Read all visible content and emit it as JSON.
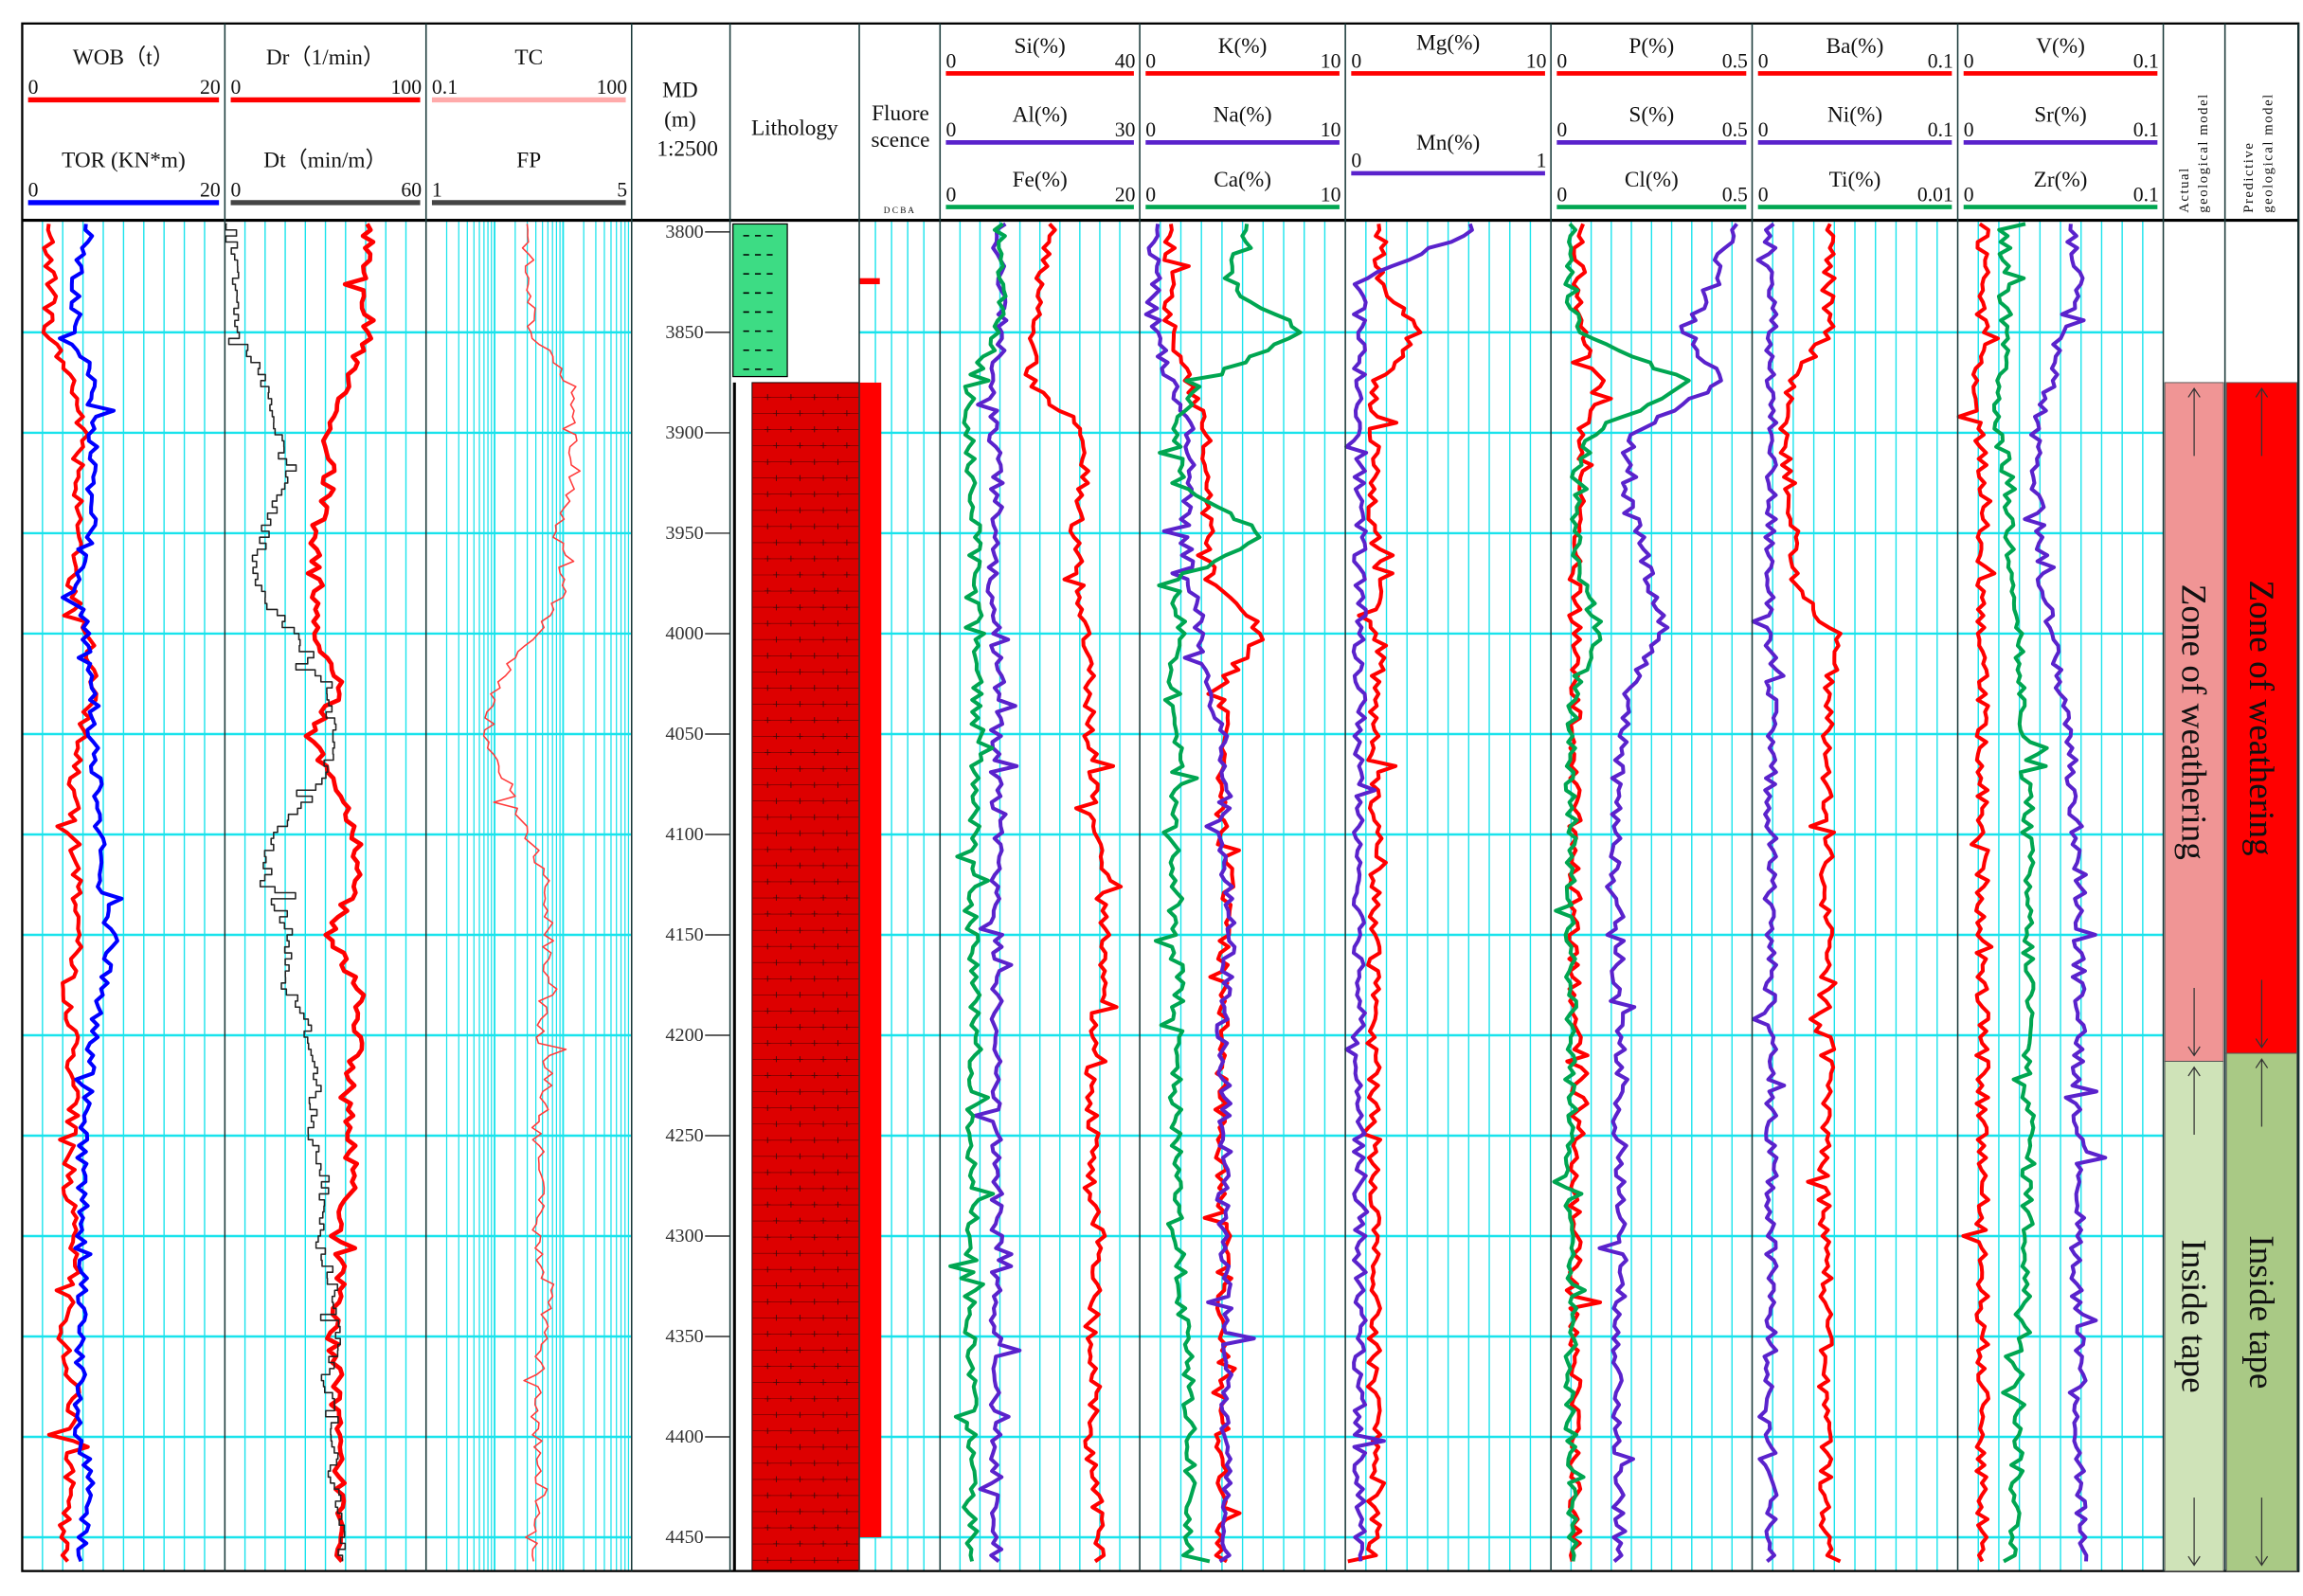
{
  "chart_data": {
    "type": "line",
    "title": "",
    "depth_axis": {
      "label": "MD",
      "unit": "(m)",
      "scale": "1:2500",
      "ticks": [
        3800,
        3850,
        3900,
        3950,
        4000,
        4050,
        4100,
        4150,
        4200,
        4250,
        4300,
        4350,
        4400,
        4450
      ],
      "range": [
        3794,
        4467
      ]
    },
    "depths": [
      3800,
      3825,
      3850,
      3875,
      3900,
      3925,
      3950,
      3975,
      4000,
      4025,
      4050,
      4075,
      4100,
      4125,
      4150,
      4175,
      4200,
      4225,
      4250,
      4275,
      4300,
      4325,
      4350,
      4375,
      4400,
      4425,
      4450
    ],
    "tracks": [
      {
        "id": "wob",
        "headers": [
          {
            "label": "WOB（t）",
            "min": "0",
            "max": "20",
            "color": "#ff0000"
          },
          {
            "label": "TOR (KN*m)",
            "min": "0",
            "max": "20",
            "color": "#0000ff"
          }
        ]
      },
      {
        "id": "dr",
        "headers": [
          {
            "label": "Dr（1/min）",
            "min": "0",
            "max": "100",
            "color": "#ff0000"
          },
          {
            "label": "Dt（min/m）",
            "min": "0",
            "max": "60",
            "color": "#444444"
          }
        ]
      },
      {
        "id": "tc",
        "headers": [
          {
            "label": "TC",
            "min": "0.1",
            "max": "100",
            "color": "#ffaaaa"
          },
          {
            "label": "FP",
            "min": "1",
            "max": "5",
            "color": "#444444"
          }
        ]
      },
      {
        "id": "si",
        "headers": [
          {
            "label": "Si(%)",
            "min": "0",
            "max": "40",
            "color": "#ff0000"
          },
          {
            "label": "Al(%)",
            "min": "0",
            "max": "30",
            "color": "#5a22cc"
          },
          {
            "label": "Fe(%)",
            "min": "0",
            "max": "20",
            "color": "#00a651"
          }
        ]
      },
      {
        "id": "k",
        "headers": [
          {
            "label": "K(%)",
            "min": "0",
            "max": "10",
            "color": "#ff0000"
          },
          {
            "label": "Na(%)",
            "min": "0",
            "max": "10",
            "color": "#5a22cc"
          },
          {
            "label": "Ca(%)",
            "min": "0",
            "max": "10",
            "color": "#00a651"
          }
        ]
      },
      {
        "id": "mg",
        "headers": [
          {
            "label": "Mg(%)",
            "min": "0",
            "max": "10",
            "color": "#ff0000"
          },
          {
            "label": "Mn(%)",
            "min": "0",
            "max": "1",
            "color": "#5a22cc"
          }
        ]
      },
      {
        "id": "p",
        "headers": [
          {
            "label": "P(%)",
            "min": "0",
            "max": "0.5",
            "color": "#ff0000"
          },
          {
            "label": "S(%)",
            "min": "0",
            "max": "0.5",
            "color": "#5a22cc"
          },
          {
            "label": "Cl(%)",
            "min": "0",
            "max": "0.5",
            "color": "#00a651"
          }
        ]
      },
      {
        "id": "ba",
        "headers": [
          {
            "label": "Ba(%)",
            "min": "0",
            "max": "0.1",
            "color": "#ff0000"
          },
          {
            "label": "Ni(%)",
            "min": "0",
            "max": "0.1",
            "color": "#5a22cc"
          },
          {
            "label": "Ti(%)",
            "min": "0",
            "max": "0.01",
            "color": "#00a651"
          }
        ]
      },
      {
        "id": "v",
        "headers": [
          {
            "label": "V(%)",
            "min": "0",
            "max": "0.1",
            "color": "#ff0000"
          },
          {
            "label": "Sr(%)",
            "min": "0",
            "max": "0.1",
            "color": "#5a22cc"
          },
          {
            "label": "Zr(%)",
            "min": "0",
            "max": "0.1",
            "color": "#00a651"
          }
        ]
      }
    ],
    "series": [
      {
        "name": "WOB",
        "track": "wob",
        "min": 0,
        "max": 20,
        "color": "#ff0000",
        "values": [
          2.5,
          3,
          2.5,
          5,
          6,
          5.5,
          6,
          4.5,
          6.5,
          7,
          6,
          5,
          5,
          5.5,
          5.5,
          4.5,
          5,
          5,
          5,
          4.5,
          5,
          5,
          4,
          5,
          5,
          4.5,
          4
        ]
      },
      {
        "name": "TOR",
        "track": "wob",
        "min": 0,
        "max": 20,
        "color": "#0000ff",
        "values": [
          6.5,
          5.5,
          5,
          7,
          7,
          7,
          7,
          5,
          6.5,
          7,
          7,
          7.5,
          8,
          7.5,
          9,
          8,
          7,
          6.5,
          6,
          6,
          6,
          6,
          6,
          5.5,
          5.5,
          7,
          6
        ]
      },
      {
        "name": "Dr",
        "track": "dr",
        "min": 0,
        "max": 100,
        "color": "#ff0000",
        "values": [
          71,
          71,
          71,
          60,
          50,
          52,
          45,
          44,
          45,
          58,
          42,
          55,
          66,
          66,
          52,
          66,
          67,
          60,
          62,
          64,
          55,
          58,
          54,
          56,
          55,
          58,
          56
        ]
      },
      {
        "name": "Dt",
        "track": "dr",
        "min": 0,
        "max": 60,
        "color": "#222222",
        "values": [
          2,
          4,
          4,
          12,
          15,
          18,
          12,
          8,
          20,
          30,
          32,
          30,
          15,
          12,
          20,
          18,
          25,
          28,
          25,
          30,
          28,
          32,
          35,
          30,
          33,
          32,
          35
        ]
      },
      {
        "name": "TC",
        "track": "tc",
        "min": 0.1,
        "max": 100,
        "log": true,
        "color": "#ff3b3b",
        "values": [
          3,
          3.5,
          3.5,
          12,
          14,
          15,
          8,
          12,
          4,
          1,
          0.8,
          1.5,
          3,
          6,
          6,
          5,
          5,
          6,
          4,
          5,
          4,
          6,
          5,
          4,
          4,
          5,
          4
        ]
      },
      {
        "name": "Si",
        "track": "si",
        "min": 0,
        "max": 40,
        "color": "#ff0000",
        "values": [
          22,
          20,
          19,
          18,
          28,
          29,
          27,
          28,
          29,
          30,
          30,
          31,
          31,
          32,
          33,
          32,
          31,
          30,
          31,
          30,
          32,
          31,
          30,
          31,
          30,
          31,
          32
        ]
      },
      {
        "name": "Al",
        "track": "si",
        "min": 0,
        "max": 30,
        "color": "#5a22cc",
        "values": [
          9,
          9,
          9.5,
          8,
          8,
          8.5,
          8.5,
          8,
          8.5,
          8.5,
          8.5,
          8.5,
          8.5,
          8.5,
          8.5,
          8.5,
          8.5,
          8.5,
          8.5,
          8.5,
          8.5,
          8.5,
          8.5,
          8.5,
          8.5,
          8.5,
          8.5
        ]
      },
      {
        "name": "Fe",
        "track": "si",
        "min": 0,
        "max": 20,
        "color": "#00a651",
        "values": [
          6,
          6,
          6,
          3,
          3,
          3.2,
          3.5,
          3.5,
          4,
          3.6,
          3.8,
          3.6,
          3.4,
          3.4,
          3.2,
          3.4,
          3.6,
          3.4,
          3.2,
          3.4,
          3.2,
          3,
          3,
          3.2,
          3,
          3.2,
          3.2
        ]
      },
      {
        "name": "K",
        "track": "k",
        "min": 0,
        "max": 10,
        "color": "#ff0000",
        "values": [
          1.4,
          1.4,
          1.5,
          2.5,
          3.2,
          3.2,
          3.4,
          3.4,
          6,
          4,
          4.2,
          4,
          4,
          4.3,
          4.2,
          4,
          4.1,
          4,
          3.9,
          4,
          4.2,
          4,
          4,
          4.2,
          4,
          4,
          4
        ]
      },
      {
        "name": "Na",
        "track": "k",
        "min": 0,
        "max": 10,
        "color": "#5a22cc",
        "values": [
          0.7,
          0.7,
          0.8,
          1.5,
          2.5,
          2.5,
          2.2,
          2.5,
          3,
          3.2,
          4,
          4.2,
          4,
          4.2,
          4.4,
          4.2,
          4,
          4.1,
          4.2,
          4,
          4.1,
          4.2,
          4.3,
          4.2,
          4.1,
          4.2,
          4.1
        ]
      },
      {
        "name": "Ca",
        "track": "k",
        "min": 0,
        "max": 10,
        "color": "#00a651",
        "values": [
          5.3,
          4,
          8,
          3,
          1.7,
          2,
          6,
          1.8,
          2,
          1.6,
          1.8,
          1.8,
          1.7,
          1.8,
          1.7,
          1.9,
          1.8,
          1.7,
          1.8,
          1.9,
          1.8,
          2,
          2.2,
          2.4,
          2.4,
          2.5,
          2.3
        ]
      },
      {
        "name": "Mg",
        "track": "mg",
        "min": 0,
        "max": 10,
        "color": "#ff0000",
        "values": [
          1.7,
          1.7,
          3.5,
          1.5,
          1.4,
          1.4,
          1.4,
          1.5,
          1.5,
          1.4,
          1.4,
          1.4,
          1.5,
          1.4,
          1.4,
          1.4,
          1.5,
          1.4,
          1.4,
          1.5,
          1.4,
          1.4,
          1.4,
          1.4,
          1.5,
          1.4,
          1.4
        ]
      },
      {
        "name": "Mn",
        "track": "mg",
        "min": 0,
        "max": 1,
        "color": "#5a22cc",
        "values": [
          0.6,
          0.07,
          0.07,
          0.07,
          0.07,
          0.07,
          0.07,
          0.07,
          0.07,
          0.07,
          0.07,
          0.07,
          0.07,
          0.07,
          0.07,
          0.07,
          0.07,
          0.07,
          0.07,
          0.07,
          0.07,
          0.07,
          0.07,
          0.07,
          0.07,
          0.07,
          0.07
        ]
      },
      {
        "name": "P",
        "track": "p",
        "min": 0,
        "max": 0.5,
        "color": "#ff0000",
        "values": [
          0.07,
          0.07,
          0.08,
          0.12,
          0.08,
          0.07,
          0.07,
          0.06,
          0.06,
          0.06,
          0.06,
          0.06,
          0.06,
          0.06,
          0.06,
          0.06,
          0.06,
          0.06,
          0.07,
          0.06,
          0.06,
          0.06,
          0.06,
          0.06,
          0.06,
          0.06,
          0.06
        ]
      },
      {
        "name": "S",
        "track": "p",
        "min": 0,
        "max": 0.5,
        "color": "#5a22cc",
        "values": [
          0.45,
          0.4,
          0.34,
          0.42,
          0.2,
          0.18,
          0.22,
          0.25,
          0.28,
          0.2,
          0.18,
          0.16,
          0.17,
          0.15,
          0.18,
          0.16,
          0.17,
          0.18,
          0.16,
          0.17,
          0.18,
          0.17,
          0.17,
          0.16,
          0.17,
          0.17,
          0.17
        ]
      },
      {
        "name": "Cl",
        "track": "p",
        "min": 0,
        "max": 0.5,
        "color": "#00a651",
        "values": [
          0.05,
          0.05,
          0.06,
          0.35,
          0.1,
          0.06,
          0.06,
          0.08,
          0.12,
          0.06,
          0.05,
          0.05,
          0.05,
          0.05,
          0.05,
          0.05,
          0.05,
          0.05,
          0.05,
          0.05,
          0.05,
          0.05,
          0.05,
          0.05,
          0.05,
          0.05,
          0.05
        ]
      },
      {
        "name": "Ba",
        "track": "ba",
        "min": 0,
        "max": 0.1,
        "color": "#ff0000",
        "values": [
          0.037,
          0.037,
          0.037,
          0.02,
          0.016,
          0.018,
          0.02,
          0.02,
          0.04,
          0.038,
          0.036,
          0.036,
          0.037,
          0.036,
          0.036,
          0.035,
          0.036,
          0.037,
          0.036,
          0.035,
          0.036,
          0.036,
          0.036,
          0.035,
          0.036,
          0.036,
          0.036
        ]
      },
      {
        "name": "Ni",
        "track": "ba",
        "min": 0,
        "max": 0.1,
        "color": "#5a22cc",
        "values": [
          0.009,
          0.009,
          0.009,
          0.009,
          0.009,
          0.009,
          0.009,
          0.009,
          0.009,
          0.009,
          0.009,
          0.009,
          0.009,
          0.009,
          0.009,
          0.009,
          0.009,
          0.009,
          0.009,
          0.009,
          0.009,
          0.009,
          0.009,
          0.009,
          0.009,
          0.009,
          0.009
        ]
      },
      {
        "name": "V",
        "track": "v",
        "min": 0,
        "max": 0.1,
        "color": "#ff0000",
        "values": [
          0.012,
          0.012,
          0.012,
          0.01,
          0.011,
          0.012,
          0.012,
          0.012,
          0.012,
          0.012,
          0.012,
          0.012,
          0.012,
          0.012,
          0.012,
          0.012,
          0.012,
          0.012,
          0.012,
          0.012,
          0.012,
          0.012,
          0.012,
          0.012,
          0.012,
          0.012,
          0.012
        ]
      },
      {
        "name": "Sr",
        "track": "v",
        "min": 0,
        "max": 0.1,
        "color": "#5a22cc",
        "values": [
          0.055,
          0.06,
          0.05,
          0.045,
          0.037,
          0.038,
          0.04,
          0.042,
          0.045,
          0.05,
          0.055,
          0.055,
          0.058,
          0.06,
          0.058,
          0.06,
          0.06,
          0.058,
          0.06,
          0.06,
          0.058,
          0.058,
          0.06,
          0.06,
          0.058,
          0.06,
          0.06
        ]
      },
      {
        "name": "Zr",
        "track": "v",
        "min": 0,
        "max": 0.1,
        "color": "#00a651",
        "values": [
          0.023,
          0.023,
          0.023,
          0.02,
          0.02,
          0.025,
          0.025,
          0.028,
          0.03,
          0.03,
          0.032,
          0.034,
          0.034,
          0.034,
          0.034,
          0.035,
          0.034,
          0.034,
          0.035,
          0.034,
          0.034,
          0.033,
          0.032,
          0.03,
          0.03,
          0.028,
          0.028
        ]
      }
    ],
    "lithology": [
      {
        "from": 3796,
        "to": 3872,
        "type": "mudstone",
        "color": "#3ddc84"
      },
      {
        "from": 3875,
        "to": 4467,
        "type": "granite",
        "color": "#dd0000"
      }
    ],
    "fluorescence": {
      "label_line1": "Fluore",
      "label_line2": "scence",
      "grades": "D  C  B  A",
      "intervals": [
        {
          "from": 3823,
          "to": 3826
        },
        {
          "from": 3875,
          "to": 4450
        }
      ]
    },
    "lithology_label": "Lithology",
    "models": {
      "actual": {
        "label_line1": "Actual",
        "label_line2": "geological model",
        "zones": [
          {
            "name": "Zone of weathering",
            "from": 3875,
            "to": 4213,
            "color": "#f09595"
          },
          {
            "name": "Inside tape",
            "from": 4213,
            "to": 4467,
            "color": "#cfe3b8"
          }
        ]
      },
      "predictive": {
        "label_line1": "Predictive",
        "label_line2": "geological model",
        "zones": [
          {
            "name": "Zone of weathering",
            "from": 3875,
            "to": 4209,
            "color": "#ff0000"
          },
          {
            "name": "Inside tape",
            "from": 4209,
            "to": 4467,
            "color": "#a9c985"
          }
        ]
      }
    }
  }
}
